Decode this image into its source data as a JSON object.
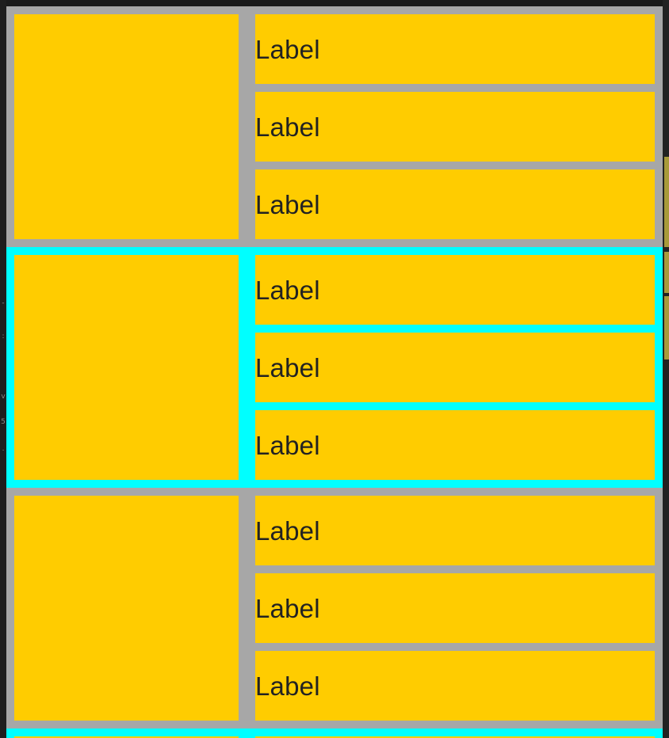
{
  "colors": {
    "background": "#a7a7a7",
    "cell": "#ffcc00",
    "selected_row": "#00ffff",
    "text": "#222222"
  },
  "selected_row_index": 1,
  "rows": [
    {
      "labels": [
        "Label",
        "Label",
        "Label"
      ]
    },
    {
      "labels": [
        "Label",
        "Label",
        "Label"
      ]
    },
    {
      "labels": [
        "Label",
        "Label",
        "Label"
      ]
    }
  ]
}
